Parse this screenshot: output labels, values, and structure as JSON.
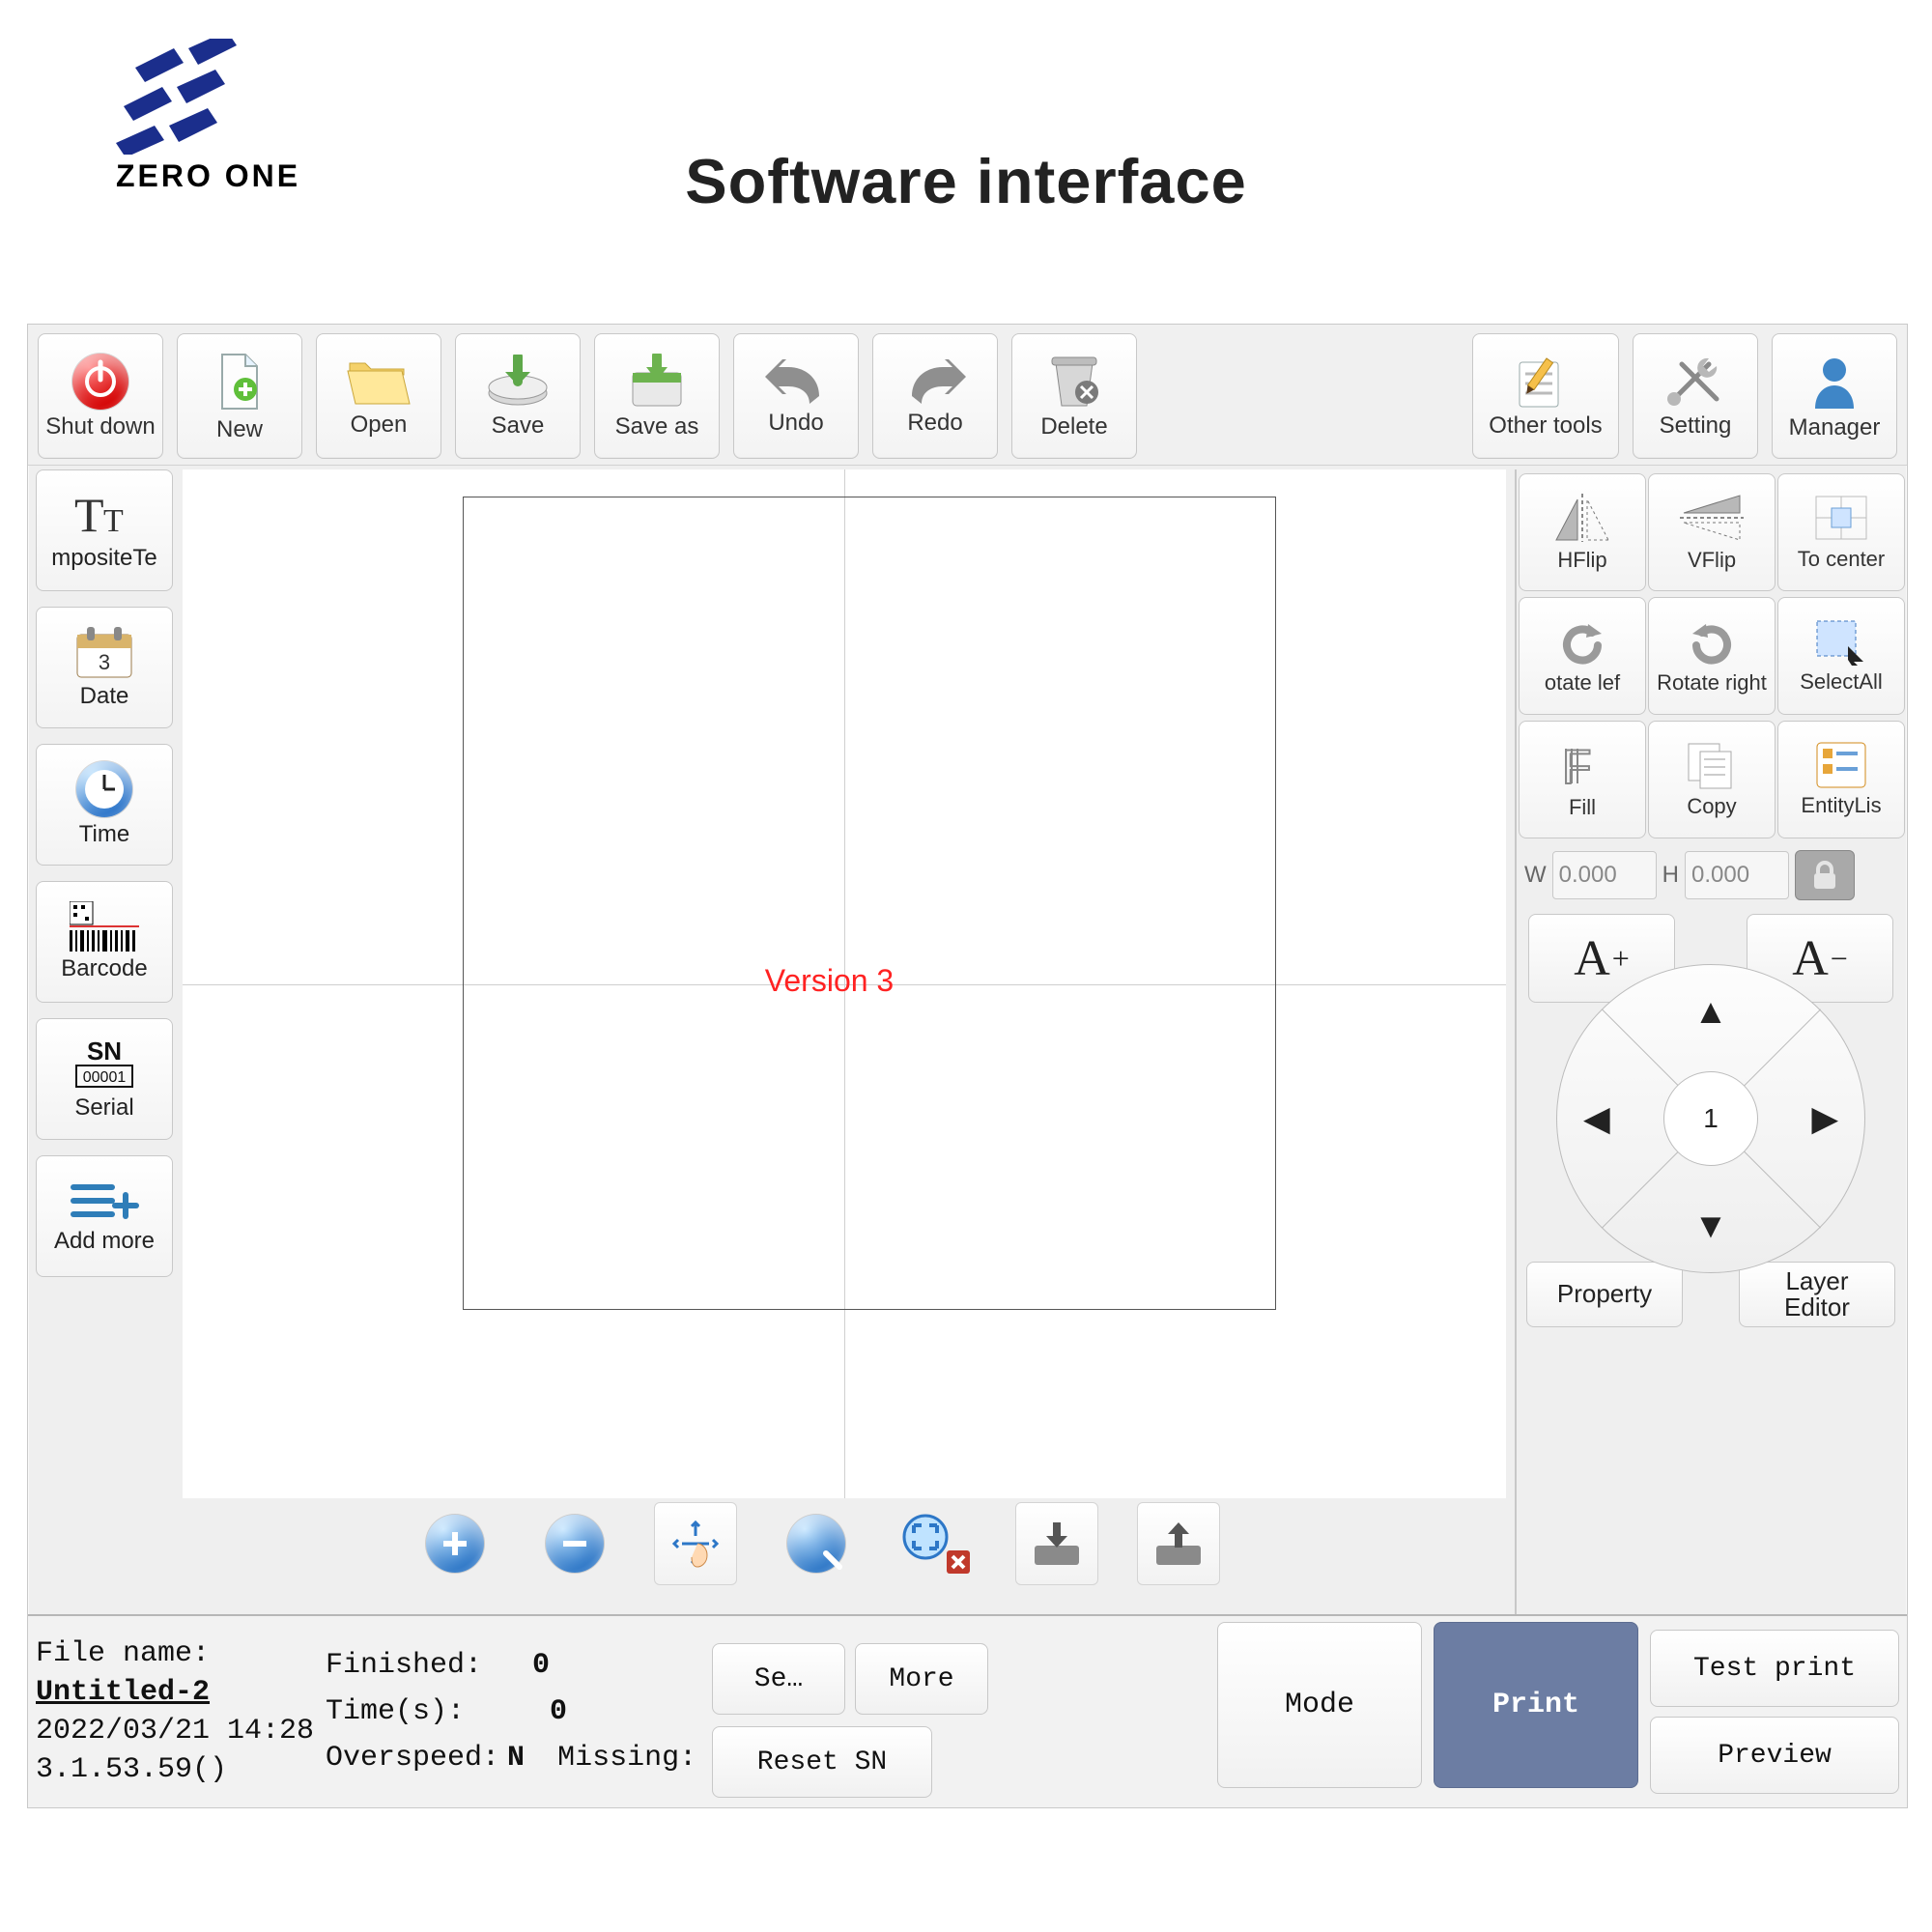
{
  "brand": "ZERO ONE",
  "heading": "Software interface",
  "toolbar": {
    "shutdown": "Shut down",
    "new": "New",
    "open": "Open",
    "save": "Save",
    "saveas": "Save as",
    "undo": "Undo",
    "redo": "Redo",
    "delete": "Delete",
    "othertools": "Other tools",
    "setting": "Setting",
    "manager": "Manager"
  },
  "leftbar": {
    "compositeText": "mpositeTe",
    "date": "Date",
    "time": "Time",
    "barcode": "Barcode",
    "serial": "Serial",
    "addmore": "Add more"
  },
  "canvas": {
    "version": "Version 3"
  },
  "viewbar": {
    "zoomin": "Zoom In",
    "zoomout": "Zoom Out",
    "pan": "Pan",
    "zoom": "Zoom",
    "fit": "Fit",
    "import": "Import",
    "export": "Export"
  },
  "rightpanel": {
    "hflip": "HFlip",
    "vflip": "VFlip",
    "tocenter": "To center",
    "rotleft": "otate lef",
    "rotright": "Rotate right",
    "selectall": "SelectAll",
    "fill": "Fill",
    "copy": "Copy",
    "entitylist": "EntityLis",
    "w_label": "W",
    "w_value": "0.000",
    "h_label": "H",
    "h_value": "0.000",
    "fontplus": "A",
    "fontminus": "A",
    "dpad_value": "1",
    "property": "Property",
    "layereditor": "Layer\nEditor"
  },
  "status": {
    "filename_label": "File name:",
    "filename": "Untitled-2",
    "timestamp": "2022/03/21 14:28",
    "version": "3.1.53.59()",
    "finished_label": "Finished:",
    "finished_value": "0",
    "times_label": "Time(s):",
    "times_value": "0",
    "overspeed_label": "Overspeed:",
    "overspeed_value": "N",
    "missing_label": "Missing:",
    "btn_sep": "Se…",
    "btn_more": "More",
    "btn_reset": "Reset SN",
    "btn_mode": "Mode",
    "btn_print": "Print",
    "btn_testprint": "Test print",
    "btn_preview": "Preview"
  }
}
